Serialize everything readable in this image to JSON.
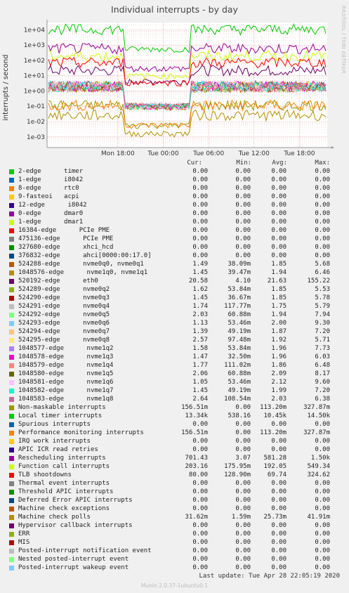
{
  "title": "Individual interrupts - by day",
  "side_text": "RRDTOOL / TOBI OETIKER",
  "footer": "Munin 2.0.37-1ubuntu0.1",
  "last_update": "Last update: Tue Apr 28 22:05:19 2020",
  "legend_headers": {
    "cur": "Cur:",
    "min": "Min:",
    "avg": "Avg:",
    "max": "Max:"
  },
  "chart_data": {
    "type": "line",
    "title": "Individual interrupts - by day",
    "ylabel": "interrupts / second",
    "yscale": "log",
    "ylim": [
      0.0002,
      30000
    ],
    "yticks": [
      "1e-03",
      "1e-02",
      "1e-01",
      "1e+00",
      "1e+01",
      "1e+02",
      "1e+03",
      "1e+04"
    ],
    "xticks": [
      "Mon 18:00",
      "Tue 00:00",
      "Tue 06:00",
      "Tue 12:00",
      "Tue 18:00"
    ],
    "grid": true,
    "series": [
      {
        "name": "2-edge      timer",
        "color": "#00cc00",
        "cur": "0.00",
        "min": "0.00",
        "avg": "0.00",
        "max": "0.00"
      },
      {
        "name": "1-edge      i8042",
        "color": "#0066b3",
        "cur": "0.00",
        "min": "0.00",
        "avg": "0.00",
        "max": "0.00"
      },
      {
        "name": "8-edge      rtc0",
        "color": "#ff8000",
        "cur": "0.00",
        "min": "0.00",
        "avg": "0.00",
        "max": "0.00"
      },
      {
        "name": "9-fasteoi   acpi",
        "color": "#ffcc00",
        "cur": "0.00",
        "min": "0.00",
        "avg": "0.00",
        "max": "0.00"
      },
      {
        "name": "12-edge      i8042",
        "color": "#330099",
        "cur": "0.00",
        "min": "0.00",
        "avg": "0.00",
        "max": "0.00"
      },
      {
        "name": "0-edge      dmar0",
        "color": "#990099",
        "cur": "0.00",
        "min": "0.00",
        "avg": "0.00",
        "max": "0.00"
      },
      {
        "name": "1-edge      dmar1",
        "color": "#ccff00",
        "cur": "0.00",
        "min": "0.00",
        "avg": "0.00",
        "max": "0.00"
      },
      {
        "name": "16384-edge      PCIe PME",
        "color": "#ff0000",
        "cur": "0.00",
        "min": "0.00",
        "avg": "0.00",
        "max": "0.00"
      },
      {
        "name": "475136-edge      PCIe PME",
        "color": "#808080",
        "cur": "0.00",
        "min": "0.00",
        "avg": "0.00",
        "max": "0.00"
      },
      {
        "name": "327680-edge      xhci_hcd",
        "color": "#008f00",
        "cur": "0.00",
        "min": "0.00",
        "avg": "0.00",
        "max": "0.00"
      },
      {
        "name": "376832-edge      ahci[0000:00:17.0]",
        "color": "#00487d",
        "cur": "0.00",
        "min": "0.00",
        "avg": "0.00",
        "max": "0.00"
      },
      {
        "name": "524288-edge      nvme0q0, nvme0q1",
        "color": "#b35a00",
        "cur": "1.49",
        "min": "38.09m",
        "avg": "1.85",
        "max": "5.68"
      },
      {
        "name": "1048576-edge      nvme1q0, nvme1q1",
        "color": "#b38f00",
        "cur": "1.45",
        "min": "39.47m",
        "avg": "1.94",
        "max": "6.46"
      },
      {
        "name": "520192-edge      eth0",
        "color": "#6b006b",
        "cur": "20.58",
        "min": "4.10",
        "avg": "21.63",
        "max": "155.22"
      },
      {
        "name": "524289-edge      nvme0q2",
        "color": "#8fb300",
        "cur": "1.62",
        "min": "53.84m",
        "avg": "1.85",
        "max": "5.53"
      },
      {
        "name": "524290-edge      nvme0q3",
        "color": "#b30000",
        "cur": "1.45",
        "min": "36.67m",
        "avg": "1.85",
        "max": "5.78"
      },
      {
        "name": "524291-edge      nvme0q4",
        "color": "#bebebe",
        "cur": "1.74",
        "min": "117.77m",
        "avg": "1.75",
        "max": "5.79"
      },
      {
        "name": "524292-edge      nvme0q5",
        "color": "#80ff80",
        "cur": "2.03",
        "min": "60.88m",
        "avg": "1.94",
        "max": "7.94"
      },
      {
        "name": "524293-edge      nvme0q6",
        "color": "#80c9ff",
        "cur": "1.13",
        "min": "53.46m",
        "avg": "2.00",
        "max": "9.30"
      },
      {
        "name": "524294-edge      nvme0q7",
        "color": "#ffc080",
        "cur": "1.39",
        "min": "49.19m",
        "avg": "1.87",
        "max": "7.20"
      },
      {
        "name": "524295-edge      nvme0q8",
        "color": "#ffe680",
        "cur": "2.57",
        "min": "97.48m",
        "avg": "1.92",
        "max": "5.71"
      },
      {
        "name": "1048577-edge      nvme1q2",
        "color": "#aa80ff",
        "cur": "1.58",
        "min": "53.84m",
        "avg": "1.96",
        "max": "7.73"
      },
      {
        "name": "1048578-edge      nvme1q3",
        "color": "#ee00cc",
        "cur": "1.47",
        "min": "32.50m",
        "avg": "1.96",
        "max": "6.03"
      },
      {
        "name": "1048579-edge      nvme1q4",
        "color": "#ff8080",
        "cur": "1.77",
        "min": "111.02m",
        "avg": "1.86",
        "max": "6.48"
      },
      {
        "name": "1048580-edge      nvme1q5",
        "color": "#666600",
        "cur": "2.06",
        "min": "60.88m",
        "avg": "2.09",
        "max": "8.17"
      },
      {
        "name": "1048581-edge      nvme1q6",
        "color": "#ffbfff",
        "cur": "1.05",
        "min": "53.46m",
        "avg": "2.12",
        "max": "9.60"
      },
      {
        "name": "1048582-edge      nvme1q7",
        "color": "#00ffcc",
        "cur": "1.45",
        "min": "49.19m",
        "avg": "1.99",
        "max": "7.20"
      },
      {
        "name": "1048583-edge      nvme1q8",
        "color": "#cc6699",
        "cur": "2.64",
        "min": "108.54m",
        "avg": "2.03",
        "max": "6.38"
      },
      {
        "name": "Non-maskable interrupts",
        "color": "#999900",
        "cur": "156.51m",
        "min": "0.00",
        "avg": "113.20m",
        "max": "327.87m"
      },
      {
        "name": "Local timer interrupts",
        "color": "#00cc00",
        "cur": "13.34k",
        "min": "538.16",
        "avg": "10.45k",
        "max": "14.50k"
      },
      {
        "name": "Spurious interrupts",
        "color": "#0066b3",
        "cur": "0.00",
        "min": "0.00",
        "avg": "0.00",
        "max": "0.00"
      },
      {
        "name": "Performance monitoring interrupts",
        "color": "#ff8000",
        "cur": "156.51m",
        "min": "0.00",
        "avg": "113.20m",
        "max": "327.87m"
      },
      {
        "name": "IRQ work interrupts",
        "color": "#ffcc00",
        "cur": "0.00",
        "min": "0.00",
        "avg": "0.00",
        "max": "0.00"
      },
      {
        "name": "APIC ICR read retries",
        "color": "#330099",
        "cur": "0.00",
        "min": "0.00",
        "avg": "0.00",
        "max": "0.00"
      },
      {
        "name": "Rescheduling interrupts",
        "color": "#990099",
        "cur": "701.43",
        "min": "3.07",
        "avg": "581.28",
        "max": "1.50k"
      },
      {
        "name": "Function call interrupts",
        "color": "#ccff00",
        "cur": "203.16",
        "min": "175.95m",
        "avg": "192.05",
        "max": "549.34"
      },
      {
        "name": "TLB shootdowns",
        "color": "#ff0000",
        "cur": "80.00",
        "min": "128.90m",
        "avg": "69.74",
        "max": "324.62"
      },
      {
        "name": "Thermal event interrupts",
        "color": "#808080",
        "cur": "0.00",
        "min": "0.00",
        "avg": "0.00",
        "max": "0.00"
      },
      {
        "name": "Threshold APIC interrupts",
        "color": "#008f00",
        "cur": "0.00",
        "min": "0.00",
        "avg": "0.00",
        "max": "0.00"
      },
      {
        "name": "Deferred Error APIC interrupts",
        "color": "#00487d",
        "cur": "0.00",
        "min": "0.00",
        "avg": "0.00",
        "max": "0.00"
      },
      {
        "name": "Machine check exceptions",
        "color": "#b35a00",
        "cur": "0.00",
        "min": "0.00",
        "avg": "0.00",
        "max": "0.00"
      },
      {
        "name": "Machine check polls",
        "color": "#b38f00",
        "cur": "31.62m",
        "min": "1.59m",
        "avg": "25.73m",
        "max": "41.91m"
      },
      {
        "name": "Hypervisor callback interrupts",
        "color": "#6b006b",
        "cur": "0.00",
        "min": "0.00",
        "avg": "0.00",
        "max": "0.00"
      },
      {
        "name": "ERR",
        "color": "#8fb300",
        "cur": "0.00",
        "min": "0.00",
        "avg": "0.00",
        "max": "0.00"
      },
      {
        "name": "MIS",
        "color": "#b30000",
        "cur": "0.00",
        "min": "0.00",
        "avg": "0.00",
        "max": "0.00"
      },
      {
        "name": "Posted-interrupt notification event",
        "color": "#bebebe",
        "cur": "0.00",
        "min": "0.00",
        "avg": "0.00",
        "max": "0.00"
      },
      {
        "name": "Nested posted-interrupt event",
        "color": "#80ff80",
        "cur": "0.00",
        "min": "0.00",
        "avg": "0.00",
        "max": "0.00"
      },
      {
        "name": "Posted-interrupt wakeup event",
        "color": "#80c9ff",
        "cur": "0.00",
        "min": "0.00",
        "avg": "0.00",
        "max": "0.00"
      }
    ]
  }
}
